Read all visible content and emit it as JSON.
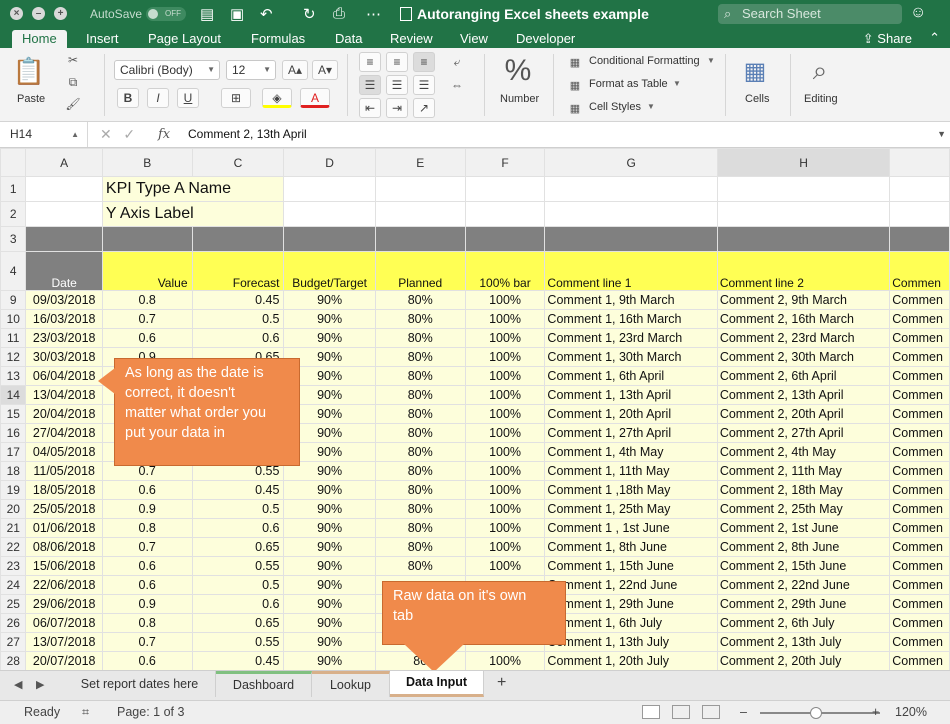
{
  "window": {
    "autosave_label": "AutoSave",
    "autosave_state": "OFF",
    "title": "Autoranging Excel sheets example",
    "search_placeholder": "Search Sheet"
  },
  "ribbon_tabs": [
    "Home",
    "Insert",
    "Page Layout",
    "Formulas",
    "Data",
    "Review",
    "View",
    "Developer"
  ],
  "share_label": "Share",
  "ribbon": {
    "paste": "Paste",
    "font_name": "Calibri (Body)",
    "font_size": "12",
    "bold": "B",
    "italic": "I",
    "underline": "U",
    "number_label": "Number",
    "number_icon": "%",
    "conditional_formatting": "Conditional Formatting",
    "format_as_table": "Format as Table",
    "cell_styles": "Cell Styles",
    "cells": "Cells",
    "editing": "Editing"
  },
  "formula_bar": {
    "cell_ref": "H14",
    "fx": "fx",
    "content": "Comment 2,  13th April"
  },
  "columns": [
    "A",
    "B",
    "C",
    "D",
    "E",
    "F",
    "G",
    "H"
  ],
  "sheet": {
    "r1": {
      "num": "1",
      "text": "KPI Type A Name"
    },
    "r2": {
      "num": "2",
      "text": "Y Axis Label"
    },
    "r3": {
      "num": "3"
    },
    "r4": {
      "num": "4",
      "headers": [
        "Date",
        "Value",
        "Forecast",
        "Budget/Target",
        "Planned",
        "100% bar",
        "Comment line 1",
        "Comment line 2",
        "Commen"
      ]
    },
    "rows": [
      {
        "num": "9",
        "cells": [
          "09/03/2018",
          "0.8",
          "0.45",
          "90%",
          "80%",
          "100%",
          "Comment 1, 9th March",
          "Comment 2, 9th March",
          "Commen"
        ]
      },
      {
        "num": "10",
        "cells": [
          "16/03/2018",
          "0.7",
          "0.5",
          "90%",
          "80%",
          "100%",
          "Comment 1, 16th March",
          "Comment 2, 16th March",
          "Commen"
        ]
      },
      {
        "num": "11",
        "cells": [
          "23/03/2018",
          "0.6",
          "0.6",
          "90%",
          "80%",
          "100%",
          "Comment 1, 23rd March",
          "Comment 2, 23rd March",
          "Commen"
        ]
      },
      {
        "num": "12",
        "cells": [
          "30/03/2018",
          "0.9",
          "0.65",
          "90%",
          "80%",
          "100%",
          "Comment 1, 30th March",
          "Comment 2, 30th March",
          "Commen"
        ]
      },
      {
        "num": "13",
        "cells": [
          "06/04/2018",
          "",
          "",
          "90%",
          "80%",
          "100%",
          "Comment 1, 6th April",
          "Comment 2, 6th April",
          "Commen"
        ]
      },
      {
        "num": "14",
        "cells": [
          "13/04/2018",
          "",
          "",
          "90%",
          "80%",
          "100%",
          "Comment 1, 13th April",
          "Comment 2,  13th April",
          "Commen"
        ]
      },
      {
        "num": "15",
        "cells": [
          "20/04/2018",
          "",
          "",
          "90%",
          "80%",
          "100%",
          "Comment 1, 20th April",
          "Comment 2,  20th April",
          "Commen"
        ]
      },
      {
        "num": "16",
        "cells": [
          "27/04/2018",
          "",
          "",
          "90%",
          "80%",
          "100%",
          "Comment 1, 27th April",
          "Comment 2,  27th April",
          "Commen"
        ]
      },
      {
        "num": "17",
        "cells": [
          "04/05/2018",
          "",
          "",
          "90%",
          "80%",
          "100%",
          "Comment 1, 4th May",
          "Comment 2,  4th May",
          "Commen"
        ]
      },
      {
        "num": "18",
        "cells": [
          "11/05/2018",
          "0.7",
          "0.55",
          "90%",
          "80%",
          "100%",
          "Comment 1, 11th May",
          "Comment 2,  11th May",
          "Commen"
        ]
      },
      {
        "num": "19",
        "cells": [
          "18/05/2018",
          "0.6",
          "0.45",
          "90%",
          "80%",
          "100%",
          "Comment 1 ,18th May",
          "Comment 2,  18th May",
          "Commen"
        ]
      },
      {
        "num": "20",
        "cells": [
          "25/05/2018",
          "0.9",
          "0.5",
          "90%",
          "80%",
          "100%",
          "Comment 1, 25th May",
          "Comment 2,  25th May",
          "Commen"
        ]
      },
      {
        "num": "21",
        "cells": [
          "01/06/2018",
          "0.8",
          "0.6",
          "90%",
          "80%",
          "100%",
          "Comment 1 , 1st June",
          "Comment 2,  1st June",
          "Commen"
        ]
      },
      {
        "num": "22",
        "cells": [
          "08/06/2018",
          "0.7",
          "0.65",
          "90%",
          "80%",
          "100%",
          "Comment 1, 8th June",
          "Comment 2,  8th June",
          "Commen"
        ]
      },
      {
        "num": "23",
        "cells": [
          "15/06/2018",
          "0.6",
          "0.55",
          "90%",
          "80%",
          "100%",
          "Comment 1, 15th June",
          "Comment 2,  15th June",
          "Commen"
        ]
      },
      {
        "num": "24",
        "cells": [
          "22/06/2018",
          "0.6",
          "0.5",
          "90%",
          "",
          "",
          "Comment 1, 22nd June",
          "Comment 2,  22nd June",
          "Commen"
        ]
      },
      {
        "num": "25",
        "cells": [
          "29/06/2018",
          "0.9",
          "0.6",
          "90%",
          "",
          "",
          "Comment 1, 29th June",
          "Comment 2,  29th June",
          "Commen"
        ]
      },
      {
        "num": "26",
        "cells": [
          "06/07/2018",
          "0.8",
          "0.65",
          "90%",
          "",
          "",
          "Comment 1, 6th July",
          "Comment 2,  6th July",
          "Commen"
        ]
      },
      {
        "num": "27",
        "cells": [
          "13/07/2018",
          "0.7",
          "0.55",
          "90%",
          "",
          "",
          "Comment 1, 13th July",
          "Comment 2,  13th July",
          "Commen"
        ]
      },
      {
        "num": "28",
        "cells": [
          "20/07/2018",
          "0.6",
          "0.45",
          "90%",
          "80",
          "100%",
          "Comment 1, 20th July",
          "Comment 2,  20th July",
          "Commen"
        ]
      }
    ]
  },
  "callouts": {
    "order": "As long as the date is\ncorrect, it doesn't\nmatter what order you\nput your data in",
    "raw": "Raw data on it's own\ntab"
  },
  "sheet_tabs": [
    "Set report dates here",
    "Dashboard",
    "Lookup",
    "Data Input"
  ],
  "active_sheet": "Data Input",
  "status": {
    "ready": "Ready",
    "page": "Page: 1 of 3",
    "zoom": "120%"
  },
  "colors": {
    "excel_green": "#217346",
    "cell_yellow": "#fdfedb",
    "header_yellow": "#ffff54",
    "band_gray": "#808080",
    "callout_orange": "#f08a4b"
  }
}
